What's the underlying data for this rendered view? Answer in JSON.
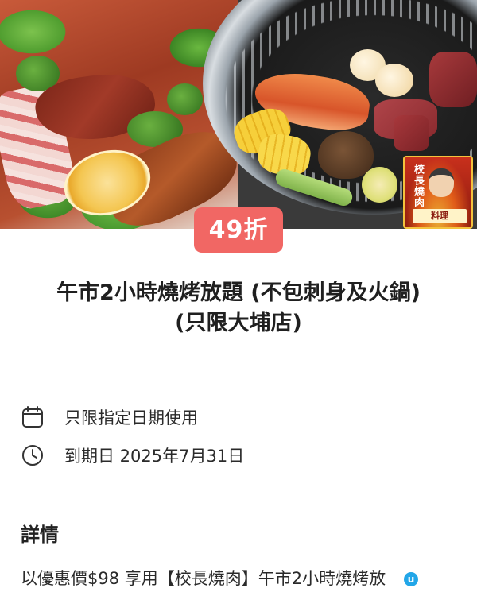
{
  "hero": {
    "badge_vertical": "校長燒肉",
    "badge_banner": "料理",
    "food_icon": "bbq-photo"
  },
  "deal": {
    "discount": "49折",
    "title_line1": "午市2小時燒烤放題 (不包刺身及火鍋)",
    "title_line2": "(只限大埔店)"
  },
  "info": {
    "date_restriction": "只限指定日期使用",
    "expiry": "到期日 2025年7月31日"
  },
  "details": {
    "heading": "詳情",
    "description": "以優惠價$98 享用【校長燒肉】午市2小時燒烤放"
  },
  "colors": {
    "discount_bg": "#f16764",
    "divider": "#e3e3e3"
  }
}
